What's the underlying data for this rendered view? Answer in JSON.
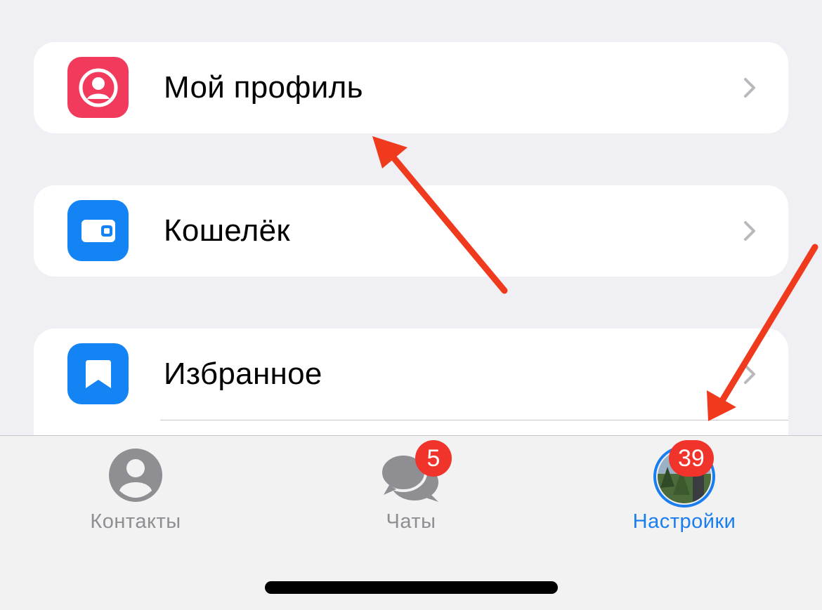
{
  "menu": {
    "items": [
      {
        "label": "Мой профиль",
        "icon": "profile-icon",
        "color": "#f23a5c"
      },
      {
        "label": "Кошелёк",
        "icon": "wallet-icon",
        "color": "#1484f5"
      },
      {
        "label": "Избранное",
        "icon": "bookmark-icon",
        "color": "#1484f5"
      }
    ],
    "chevron_color": "#b8b8bd"
  },
  "tabbar": {
    "tabs": [
      {
        "label": "Контакты",
        "icon": "person-icon",
        "active": false
      },
      {
        "label": "Чаты",
        "icon": "chat-bubbles-icon",
        "active": false,
        "badge": "5"
      },
      {
        "label": "Настройки",
        "icon": "avatar",
        "active": true,
        "badge": "39"
      }
    ],
    "active_color": "#1a7ef0",
    "inactive_color": "#8e8e93",
    "badge_color": "#f0342c"
  },
  "annotations": {
    "arrow_color": "#f03a1e"
  }
}
